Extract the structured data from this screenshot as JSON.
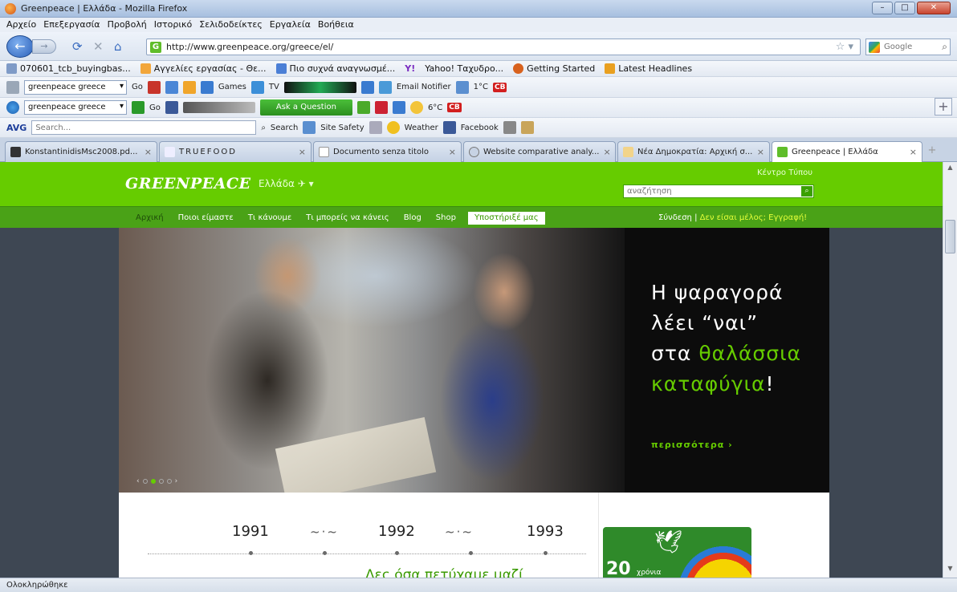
{
  "window": {
    "title": "Greenpeace | Ελλάδα - Mozilla Firefox"
  },
  "menu": [
    "Αρχείο",
    "Επεξεργασία",
    "Προβολή",
    "Ιστορικό",
    "Σελιδοδείκτες",
    "Εργαλεία",
    "Βοήθεια"
  ],
  "nav": {
    "url": "http://www.greenpeace.org/greece/el/",
    "search_placeholder": "Google"
  },
  "bookmarks": [
    {
      "label": "070601_tcb_buyingbas...",
      "color": "#7f9bc7"
    },
    {
      "label": "Αγγελίες εργασίας - Θε...",
      "color": "#f2a63a"
    },
    {
      "label": "Πιο συχνά αναγνωσμέ...",
      "color": "#4b7fd6"
    },
    {
      "label": "Yahoo! Ταχυδρο...",
      "color": "#7a2cc0"
    },
    {
      "label": "Getting Started",
      "color": "#d8621e"
    },
    {
      "label": "Latest Headlines",
      "color": "#e9a020"
    }
  ],
  "toolbar1": {
    "combo": "greenpeace greece",
    "go": "Go",
    "games": "Games",
    "tv": "TV",
    "email": "Email Notifier",
    "temp": "1°C",
    "cb": "CB"
  },
  "toolbar2": {
    "combo": "greenpeace greece",
    "go": "Go",
    "ask": "Ask a Question",
    "temp": "6°C",
    "cb": "CB"
  },
  "toolbar3": {
    "avg": "AVG",
    "search_placeholder": "Search...",
    "search": "Search",
    "site_safety": "Site Safety",
    "weather": "Weather",
    "facebook": "Facebook"
  },
  "tabs": [
    {
      "label": "KonstantinidisMsc2008.pd...",
      "active": false
    },
    {
      "label": "TRUEFOOD",
      "active": false
    },
    {
      "label": "Documento senza titolo",
      "active": false
    },
    {
      "label": "Website comparative analy...",
      "active": false
    },
    {
      "label": "Νέα Δημοκρατία: Αρχική σ...",
      "active": false
    },
    {
      "label": "Greenpeace | Ελλάδα",
      "active": true
    }
  ],
  "site": {
    "logo": "GREENPEACE",
    "country": "Ελλάδα",
    "press": "Κέντρο Τύπου",
    "search_placeholder": "αναζήτηση",
    "menu": [
      "Αρχική",
      "Ποιοι είμαστε",
      "Τι κάνουμε",
      "Τι μπορείς να κάνεις",
      "Blog",
      "Shop"
    ],
    "support": "Υποστήριξέ μας",
    "login": "Σύνδεση",
    "register_q": "Δεν είσαι μέλος;",
    "register": "Εγγραφή!",
    "hero": {
      "line1": "Η ψαραγορά",
      "line2": "λέει “ναι”",
      "line3a": "στα ",
      "line3b": "θαλάσσια",
      "line4a": "καταφύγια",
      "line4b": "!",
      "more": "περισσότερα ›"
    },
    "timeline": {
      "years": [
        "1991",
        "1992",
        "1993"
      ],
      "caption": "Δες όσα πετύχαμε μαζί"
    },
    "badge": {
      "num": "20",
      "years": "χρόνια"
    }
  },
  "status": "Ολοκληρώθηκε",
  "colors": {
    "brand_green": "#66cc00",
    "nav_green": "#4aa217"
  }
}
